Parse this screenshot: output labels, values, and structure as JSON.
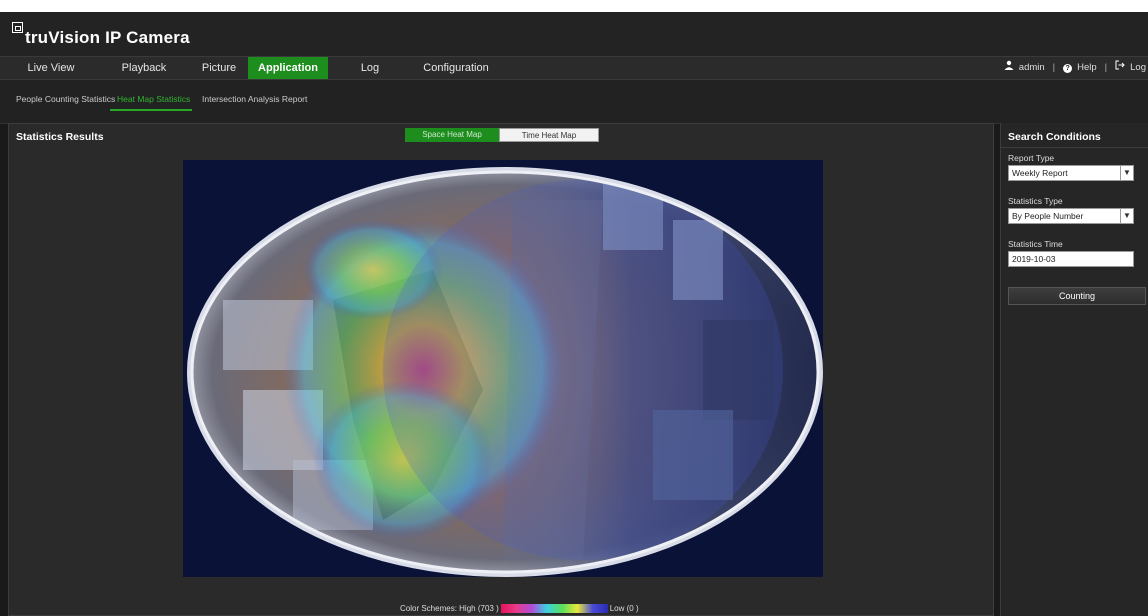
{
  "app": {
    "brand": "truVision IP Camera"
  },
  "nav": {
    "items": [
      "Live View",
      "Playback",
      "Picture",
      "Application",
      "Log",
      "Configuration"
    ],
    "active": "Application"
  },
  "user": {
    "name": "admin",
    "help": "Help",
    "logout": "Log"
  },
  "subnav": {
    "items": [
      "People Counting Statistics",
      "Heat Map Statistics",
      "Intersection Analysis Report"
    ],
    "active": "Heat Map Statistics"
  },
  "main": {
    "title": "Statistics Results",
    "toggle_space": "Space Heat Map",
    "toggle_time": "Time Heat Map",
    "legend": {
      "label": "Color Schemes:",
      "high": "High (703 )",
      "low": "Low (0 )"
    }
  },
  "side": {
    "title": "Search Conditions",
    "report_type_label": "Report Type",
    "report_type_value": "Weekly Report",
    "statistics_type_label": "Statistics Type",
    "statistics_type_value": "By People Number",
    "statistics_time_label": "Statistics Time",
    "statistics_time_value": "2019-10-03",
    "counting_button": "Counting"
  },
  "colors": {
    "accent_green": "#1d8d1d",
    "active_sub_green": "#2fb52f"
  }
}
